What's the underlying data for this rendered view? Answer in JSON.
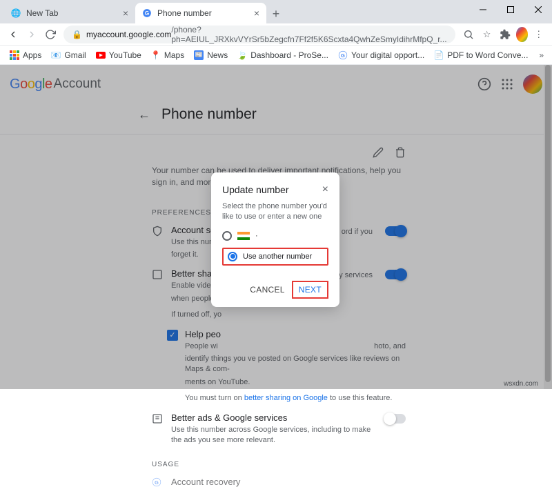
{
  "window": {
    "tabs": [
      {
        "label": "New Tab",
        "active": false
      },
      {
        "label": "Phone number",
        "active": true
      }
    ]
  },
  "toolbar": {
    "url_domain": "myaccount.google.com",
    "url_path": "/phone?ph=AEIUL_JRXkvVYrSr5bZegcfn7Ff2f5K6Scxta4QwhZeSmyIdihrMfpQ_r..."
  },
  "bookmarks": {
    "items": [
      {
        "label": "Apps"
      },
      {
        "label": "Gmail"
      },
      {
        "label": "YouTube"
      },
      {
        "label": "Maps"
      },
      {
        "label": "News"
      },
      {
        "label": "Dashboard - ProSe..."
      },
      {
        "label": "Your digital opport..."
      },
      {
        "label": "PDF to Word Conve..."
      }
    ]
  },
  "header": {
    "brand_account": "Account"
  },
  "page": {
    "title": "Phone number",
    "number_desc": "Your number can be used to deliver important notifications, help you sign in, and more",
    "preferences_label": "PREFERENCES",
    "rows": {
      "security": {
        "title": "Account secu",
        "desc": "Use this numbe",
        "desc2": "forget it.",
        "tail": "ord if you"
      },
      "sharing": {
        "title": "Better sharin",
        "desc1": "Enable video ca",
        "desc2": "when people se",
        "desc3": "If turned off, yo",
        "tail": "y services"
      },
      "help": {
        "title": "Help peo",
        "desc1": "People wi",
        "tail1": "hoto, and",
        "desc2": "identify things you ve posted on Google services like reviews on Maps & com-",
        "desc3": "ments on YouTube.",
        "desc4a": "You must turn on ",
        "desc4b": "better sharing on Google",
        "desc4c": " to use this feature."
      },
      "ads": {
        "title": "Better ads & Google services",
        "desc": "Use this number across Google services, including to make the ads you see more relevant."
      }
    },
    "usage_label": "USAGE",
    "usage_row": "Account recovery"
  },
  "modal": {
    "title": "Update number",
    "desc": "Select the phone number you'd like to use or enter a new one",
    "option_flag_suffix": "·",
    "option_another": "Use another number",
    "cancel": "CANCEL",
    "next": "NEXT"
  },
  "footer": "wsxdn.com"
}
